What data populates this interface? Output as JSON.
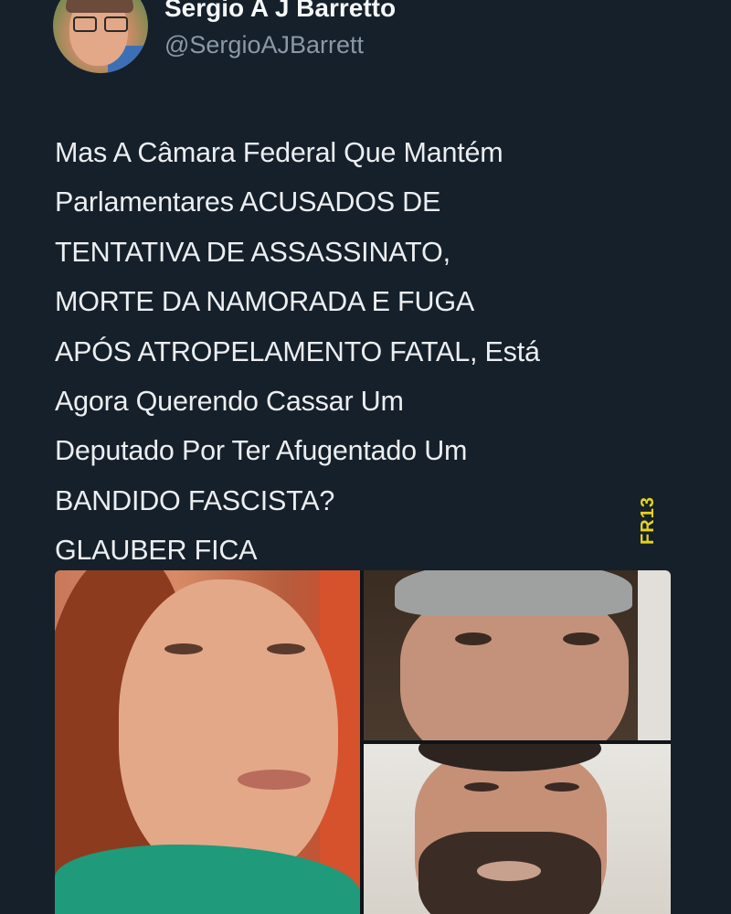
{
  "author": {
    "display_name": "Sergio A J Barretto",
    "handle": "@SergioAJBarrett",
    "avatar_icon": "profile-photo"
  },
  "tweet": {
    "lines": [
      "Mas A Câmara Federal Que Mantém",
      "Parlamentares ACUSADOS DE",
      "TENTATIVA DE ASSASSINATO,",
      "MORTE DA NAMORADA E FUGA",
      "APÓS ATROPELAMENTO FATAL, Está",
      "Agora Querendo Cassar Um",
      "Deputado Por Ter Afugentado Um",
      "BANDIDO FASCISTA?",
      "GLAUBER FICA"
    ]
  },
  "watermark": {
    "text": "FR13",
    "color": "#e6d21b"
  },
  "theme": {
    "background": "#15202b",
    "text": "#e7e9ea",
    "secondary_text": "#8b98a5"
  }
}
